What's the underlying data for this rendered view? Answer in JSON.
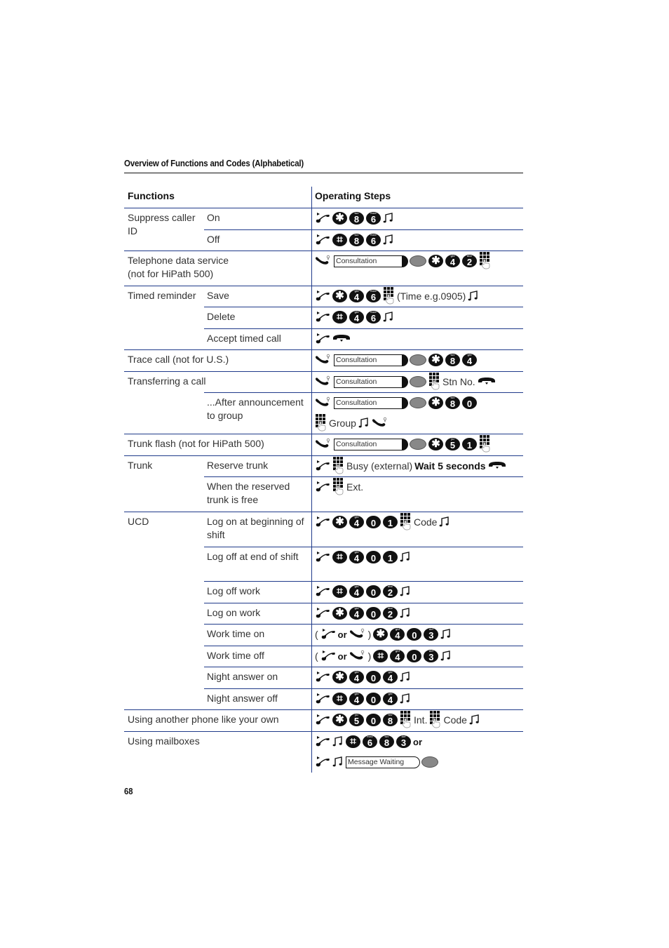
{
  "page": {
    "section_title": "Overview of Functions and Codes (Alphabetical)",
    "page_number": "68"
  },
  "table": {
    "headers": {
      "functions": "Functions",
      "steps": "Operating Steps"
    },
    "rows": [
      {
        "group": "Suppress caller ID",
        "sub": "On",
        "steps": [
          "lift",
          "key:*",
          "key:8",
          "key:6",
          "tone"
        ]
      },
      {
        "group": "",
        "sub": "Off",
        "steps": [
          "lift",
          "key:#",
          "key:8",
          "key:6",
          "tone"
        ]
      },
      {
        "group": "Telephone data service (not for HiPath 500)",
        "sub": "",
        "steps": [
          "offhook",
          "display:Consultation",
          "key:*",
          "key:4",
          "key:2",
          "keypad"
        ]
      },
      {
        "group": "Timed reminder",
        "sub": "Save",
        "steps": [
          "lift",
          "key:*",
          "key:4",
          "key:6",
          "keypad",
          "text:(Time e.g.0905)",
          "tone"
        ]
      },
      {
        "group": "",
        "sub": "Delete",
        "steps": [
          "lift",
          "key:#",
          "key:4",
          "key:6",
          "tone"
        ]
      },
      {
        "group": "",
        "sub": "Accept timed call",
        "steps": [
          "lift",
          "hangup"
        ]
      },
      {
        "group": "Trace call (not for U.S.)",
        "sub": "",
        "steps": [
          "offhook",
          "display:Consultation",
          "key:*",
          "key:8",
          "key:4"
        ]
      },
      {
        "group": "Transferring a call",
        "sub": "",
        "steps": [
          "offhook",
          "display:Consultation",
          "keypad",
          "text:Stn No.",
          "hangup"
        ]
      },
      {
        "group": "",
        "sub": "...After announcement to group",
        "steps": [
          "offhook",
          "display:Consultation",
          "key:*",
          "key:8",
          "key:0"
        ],
        "steps2": [
          "keypad",
          "text:Group",
          "tone",
          "offhook"
        ]
      },
      {
        "group": "Trunk flash (not for HiPath 500)",
        "sub": "",
        "steps": [
          "offhook",
          "display:Consultation",
          "key:*",
          "key:5",
          "key:1",
          "keypad"
        ]
      },
      {
        "group": "Trunk",
        "sub": "Reserve trunk",
        "steps": [
          "lift",
          "keypad",
          "text:Busy (external)",
          "bold:Wait 5 seconds",
          "hangup"
        ]
      },
      {
        "group": "",
        "sub": "When the reserved trunk is free",
        "steps": [
          "lift",
          "keypad",
          "text:Ext."
        ]
      },
      {
        "group": "UCD",
        "sub": "Log on at beginning of shift",
        "steps": [
          "lift",
          "key:*",
          "key:4",
          "key:0",
          "key:1",
          "keypad",
          "text:Code",
          "tone"
        ]
      },
      {
        "group": "",
        "sub": "Log off at end of shift",
        "steps": [
          "lift",
          "key:#",
          "key:4",
          "key:0",
          "key:1",
          "tone"
        ]
      },
      {
        "group": "",
        "sub": "Log off work",
        "steps": [
          "lift",
          "key:#",
          "key:4",
          "key:0",
          "key:2",
          "tone"
        ]
      },
      {
        "group": "",
        "sub": "Log on work",
        "steps": [
          "lift",
          "key:*",
          "key:4",
          "key:0",
          "key:2",
          "tone"
        ]
      },
      {
        "group": "",
        "sub": "Work time on",
        "steps": [
          "text:(",
          "lift",
          "or:or",
          "offhook",
          "text:)",
          "key:*",
          "key:4",
          "key:0",
          "key:3",
          "tone"
        ]
      },
      {
        "group": "",
        "sub": "Work time off",
        "steps": [
          "text:(",
          "lift",
          "or:or",
          "offhook",
          "text:)",
          "key:#",
          "key:4",
          "key:0",
          "key:3",
          "tone"
        ]
      },
      {
        "group": "",
        "sub": "Night answer on",
        "steps": [
          "lift",
          "key:*",
          "key:4",
          "key:0",
          "key:4",
          "tone"
        ]
      },
      {
        "group": "",
        "sub": "Night answer off",
        "steps": [
          "lift",
          "key:#",
          "key:4",
          "key:0",
          "key:4",
          "tone"
        ]
      },
      {
        "group": "Using another phone like your own",
        "sub": "",
        "steps": [
          "lift",
          "key:*",
          "key:5",
          "key:0",
          "key:8",
          "keypad",
          "text:Int.",
          "keypad",
          "text:Code",
          "tone"
        ]
      },
      {
        "group": "Using mailboxes",
        "sub": "",
        "steps": [
          "lift",
          "tone",
          "key:#",
          "key:6",
          "key:8",
          "key:3",
          "or:or"
        ],
        "steps2": [
          "lift",
          "tone",
          "display-open:Message Waiting"
        ]
      }
    ]
  },
  "key_letters": {
    "2": "abc",
    "3": "def",
    "4": "ghi",
    "5": "jkl",
    "6": "mno",
    "8": "tuv"
  }
}
